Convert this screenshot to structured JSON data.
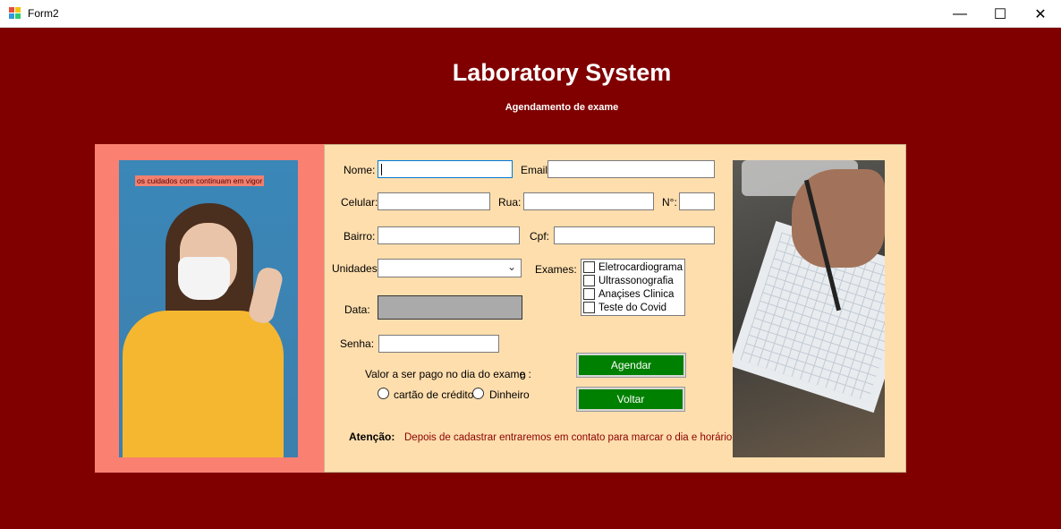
{
  "window": {
    "title": "Form2",
    "minimize": "—",
    "maximize": "☐",
    "close": "✕"
  },
  "header": {
    "title": "Laboratory System",
    "subtitle": "Agendamento de exame"
  },
  "left_image": {
    "caption": "os cuidados com  continuam em vigor"
  },
  "form": {
    "nome_label": "Nome:",
    "email_label": "Email:",
    "celular_label": "Celular:",
    "rua_label": "Rua:",
    "numero_label": "N°:",
    "bairro_label": "Bairro:",
    "cpf_label": "Cpf:",
    "unidades_label": "Unidades:",
    "exames_label": "Exames:",
    "data_label": "Data:",
    "senha_label": "Senha:",
    "valor_label": "Valor a ser pago no dia do exame :",
    "valor_value": "0",
    "exames": [
      {
        "label": "Eletrocardiograma",
        "checked": false
      },
      {
        "label": "Ultrassonografia",
        "checked": false
      },
      {
        "label": "Anaçises Clinica",
        "checked": false
      },
      {
        "label": "Teste do Covid",
        "checked": false
      }
    ],
    "payment_options": [
      "cartão de crédito",
      "Dinheiro"
    ],
    "agendar_button": "Agendar",
    "voltar_button": "Voltar",
    "atencao_label": "Atenção:",
    "atencao_text": "Depois de cadastrar entraremos em contato para marcar o dia e horário"
  },
  "colors": {
    "background": "#800000",
    "left_panel": "#fa8072",
    "form_panel": "#ffdead",
    "button": "#008000",
    "warning_text": "#8b0000"
  }
}
